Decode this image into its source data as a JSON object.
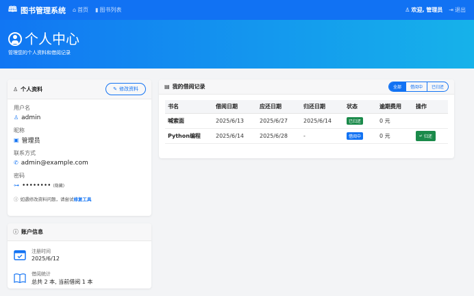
{
  "nav": {
    "brand": "图书管理系统",
    "links": [
      "首页",
      "图书列表"
    ],
    "welcome": "欢迎, 管理员",
    "logout": "退出"
  },
  "hero": {
    "title": "个人中心",
    "subtitle": "管理您的个人资料和借阅记录"
  },
  "profile": {
    "title": "个人资料",
    "edit_button": "修改资料",
    "fields": [
      {
        "label": "用户名",
        "value": "admin",
        "icon": "user-icon"
      },
      {
        "label": "昵称",
        "value": "管理员",
        "icon": "badge-icon"
      },
      {
        "label": "联系方式",
        "value": "admin@example.com",
        "icon": "phone-icon"
      },
      {
        "label": "密码",
        "value": "••••••••",
        "note": "(隐藏)",
        "icon": "key-icon"
      }
    ],
    "help_text": "如遇修改资料问题，请尝试",
    "help_link": "修复工具"
  },
  "account": {
    "title": "账户信息",
    "register_label": "注册时间",
    "register_date": "2025/6/12",
    "borrow_label": "借阅统计",
    "borrow_stats": "总共 2 本, 当前借阅 1 本"
  },
  "borrow": {
    "title": "我的借阅记录",
    "filters": [
      "全部",
      "借阅中",
      "已归还"
    ],
    "columns": [
      "书名",
      "借阅日期",
      "应还日期",
      "归还日期",
      "状态",
      "逾期费用",
      "操作"
    ],
    "rows": [
      {
        "book": "喊索面",
        "borrow_date": "2025/6/13",
        "due_date": "2025/6/27",
        "return_date": "2025/6/14",
        "status": "已归还",
        "fee": "0 元",
        "action": ""
      },
      {
        "book": "Python编程",
        "borrow_date": "2025/6/14",
        "due_date": "2025/6/28",
        "return_date": "-",
        "status": "借阅中",
        "fee": "0 元",
        "action": "归还"
      }
    ]
  },
  "colors": {
    "primary": "#1172f3",
    "success": "#1a8a4a",
    "hero_end": "#16b2ea"
  }
}
